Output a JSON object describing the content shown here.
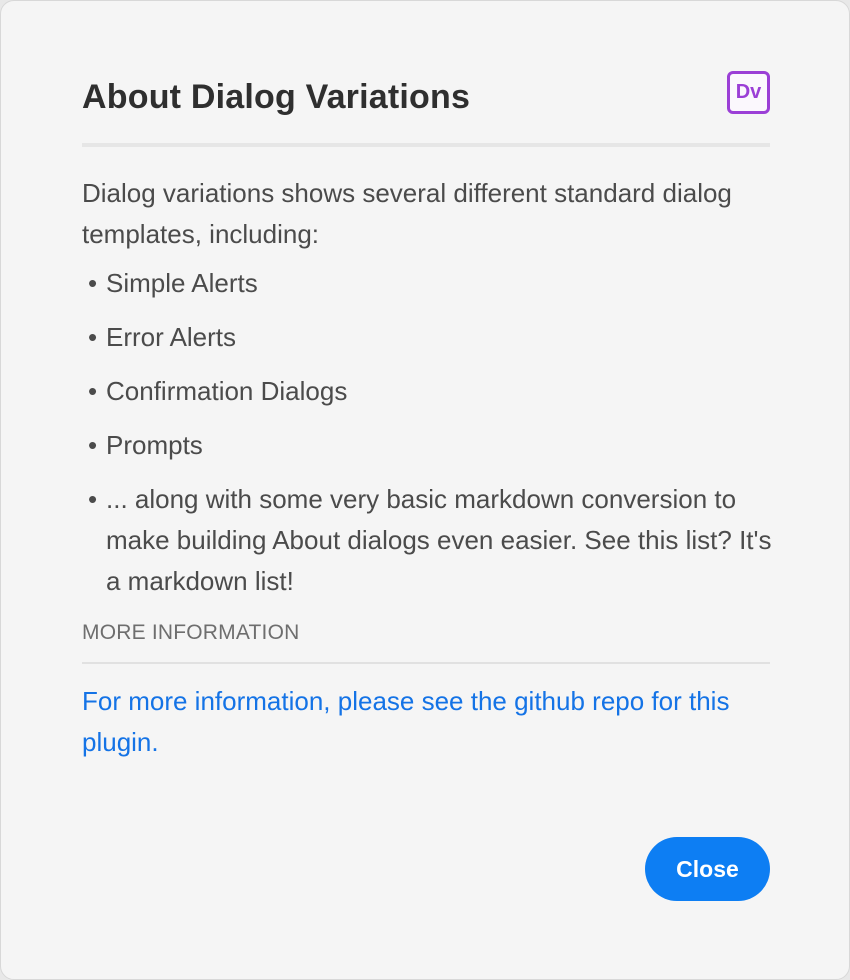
{
  "dialog": {
    "title": "About Dialog Variations",
    "app_icon": {
      "icon": "plugin-logo-icon",
      "text": "Dv",
      "color": "#9b3fd6"
    },
    "intro": "Dialog variations shows several different standard dialog templates, including:",
    "list": [
      {
        "bullet": "•",
        "text": "Simple Alerts"
      },
      {
        "bullet": "•",
        "text": "Error Alerts"
      },
      {
        "bullet": "•",
        "text": "Confirmation Dialogs"
      },
      {
        "bullet": "•",
        "text": "Prompts"
      },
      {
        "bullet": "•",
        "text": "... along with some very basic markdown conversion to make building About dialogs even easier. See this list? It's a markdown list!"
      }
    ],
    "section_label": "MORE INFORMATION",
    "info_link": "For more information, please see the github repo for this plugin.",
    "close_label": "Close"
  },
  "colors": {
    "background": "#f5f5f5",
    "accent": "#0d7ef3",
    "link": "#1473e6",
    "icon": "#9b3fd6"
  }
}
